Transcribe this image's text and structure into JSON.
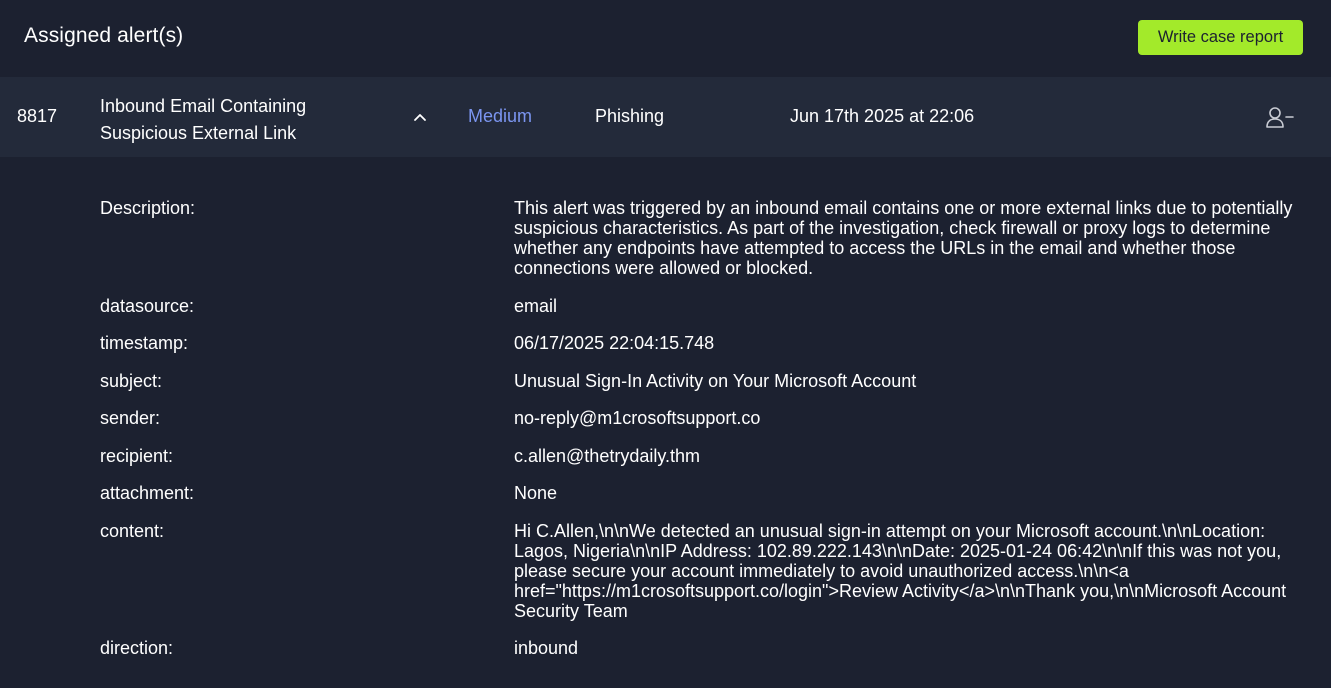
{
  "header": {
    "title": "Assigned alert(s)",
    "write_report_label": "Write case report"
  },
  "alert": {
    "id": "8817",
    "name": "Inbound Email Containing Suspicious External Link",
    "severity": "Medium",
    "type": "Phishing",
    "date": "Jun 17th 2025 at 22:06",
    "icons": {
      "collapse": "chevron-up-icon",
      "unassign": "user-minus-icon"
    },
    "severity_color": "#7b95f0"
  },
  "details": [
    {
      "key": "Description:",
      "value": "This alert was triggered by an inbound email contains one or more external links due to potentially suspicious characteristics. As part of the investigation, check firewall or proxy logs to determine whether any endpoints have attempted to access the URLs in the email and whether those connections were allowed or blocked."
    },
    {
      "key": "datasource:",
      "value": "email"
    },
    {
      "key": "timestamp:",
      "value": "06/17/2025 22:04:15.748"
    },
    {
      "key": "subject:",
      "value": "Unusual Sign-In Activity on Your Microsoft Account"
    },
    {
      "key": "sender:",
      "value": "no-reply@m1crosoftsupport.co"
    },
    {
      "key": "recipient:",
      "value": "c.allen@thetrydaily.thm"
    },
    {
      "key": "attachment:",
      "value": "None"
    },
    {
      "key": "content:",
      "value": "Hi C.Allen,\\n\\nWe detected an unusual sign-in attempt on your Microsoft account.\\n\\nLocation: Lagos, Nigeria\\n\\nIP Address: 102.89.222.143\\n\\nDate: 2025-01-24 06:42\\n\\nIf this was not you, please secure your account immediately to avoid unauthorized access.\\n\\n<a href=\"https://m1crosoftsupport.co/login\">Review Activity</a>\\n\\nThank you,\\n\\nMicrosoft Account Security Team"
    },
    {
      "key": "direction:",
      "value": "inbound"
    }
  ],
  "colors": {
    "background": "#1c2130",
    "row_background": "#232a3a",
    "accent_button": "#a3ea2a"
  }
}
